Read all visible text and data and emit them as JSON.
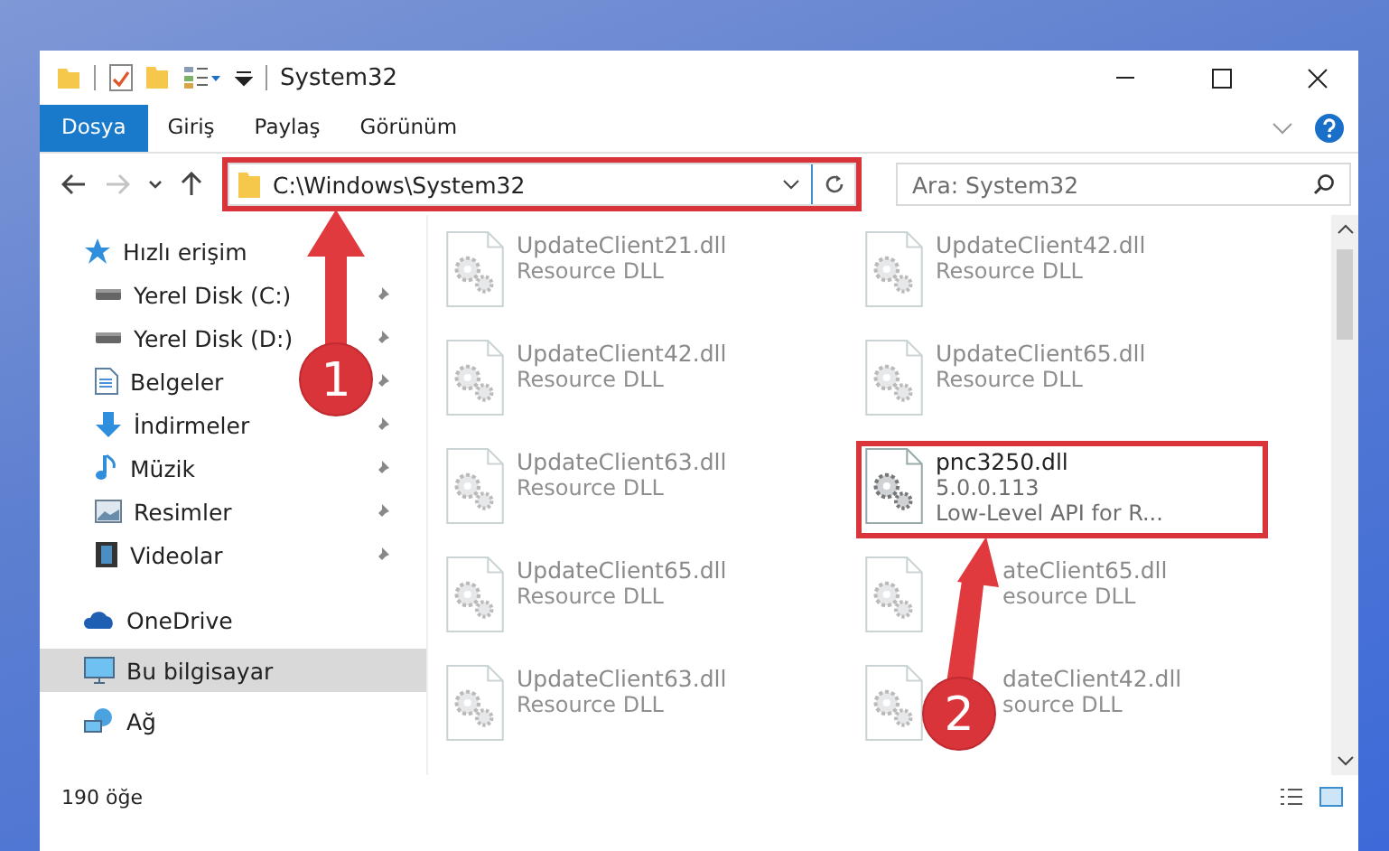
{
  "window": {
    "title": "System32"
  },
  "ribbon": {
    "tabs": [
      {
        "label": "Dosya",
        "kind": "file",
        "selected": false
      },
      {
        "label": "Giriş",
        "kind": "tab",
        "selected": false
      },
      {
        "label": "Paylaş",
        "kind": "tab",
        "selected": false
      },
      {
        "label": "Görünüm",
        "kind": "tab",
        "selected": false
      }
    ]
  },
  "navigation": {
    "back_disabled": false,
    "forward_disabled": true
  },
  "address_bar": {
    "value": "C:\\Windows\\System32",
    "highlighted": true
  },
  "search": {
    "placeholder": "Ara: System32"
  },
  "sidebar": {
    "items": [
      {
        "label": "Hızlı erişim",
        "kind": "star",
        "selected": false,
        "children": [
          {
            "label": "Yerel Disk (C:)",
            "kind": "drive",
            "pinned": true,
            "selected": false
          },
          {
            "label": "Yerel Disk (D:)",
            "kind": "drive",
            "pinned": true,
            "selected": false
          },
          {
            "label": "Belgeler",
            "kind": "document",
            "pinned": true,
            "selected": false
          },
          {
            "label": "İndirmeler",
            "kind": "download",
            "pinned": true,
            "selected": false
          },
          {
            "label": "Müzik",
            "kind": "music",
            "pinned": true,
            "selected": false
          },
          {
            "label": "Resimler",
            "kind": "pictures",
            "pinned": true,
            "selected": false
          },
          {
            "label": "Videolar",
            "kind": "video",
            "pinned": true,
            "selected": false
          }
        ]
      },
      {
        "label": "OneDrive",
        "kind": "cloud",
        "selected": false
      },
      {
        "label": "Bu bilgisayar",
        "kind": "computer",
        "selected": true
      },
      {
        "label": "Ağ",
        "kind": "network",
        "selected": false
      }
    ]
  },
  "files": [
    {
      "name": "UpdateClient21.dll",
      "details": [
        "Resource DLL"
      ],
      "dimmed": true,
      "highlighted": false,
      "partly_covered": false
    },
    {
      "name": "UpdateClient42.dll",
      "details": [
        "Resource DLL"
      ],
      "dimmed": true,
      "highlighted": false,
      "partly_covered": false
    },
    {
      "name": "UpdateClient42.dll",
      "details": [
        "Resource DLL"
      ],
      "dimmed": true,
      "highlighted": false,
      "partly_covered": false
    },
    {
      "name": "UpdateClient65.dll",
      "details": [
        "Resource DLL"
      ],
      "dimmed": true,
      "highlighted": false,
      "partly_covered": false
    },
    {
      "name": "UpdateClient63.dll",
      "details": [
        "Resource DLL"
      ],
      "dimmed": true,
      "highlighted": false,
      "partly_covered": false
    },
    {
      "name": "pnc3250.dll",
      "details": [
        "5.0.0.113",
        "Low-Level API for R..."
      ],
      "dimmed": false,
      "highlighted": true,
      "partly_covered": false
    },
    {
      "name": "UpdateClient65.dll",
      "details": [
        "Resource DLL"
      ],
      "dimmed": true,
      "highlighted": false,
      "partly_covered": false
    },
    {
      "name": "ateClient65.dll",
      "details": [
        "esource DLL"
      ],
      "dimmed": true,
      "highlighted": false,
      "partly_covered": true
    },
    {
      "name": "UpdateClient63.dll",
      "details": [
        "Resource DLL"
      ],
      "dimmed": true,
      "highlighted": false,
      "partly_covered": false
    },
    {
      "name": "dateClient42.dll",
      "details": [
        "source DLL"
      ],
      "dimmed": true,
      "highlighted": false,
      "partly_covered": true
    }
  ],
  "status_bar": {
    "item_count": "190 öğe"
  },
  "callouts": [
    {
      "number": "1"
    },
    {
      "number": "2"
    }
  ]
}
